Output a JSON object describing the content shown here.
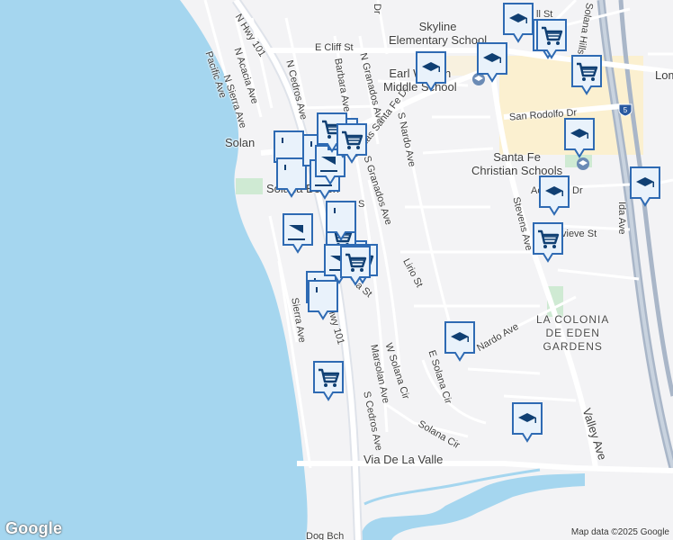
{
  "map": {
    "colors": {
      "water": "#a5d6ef",
      "land": "#f3f3f5",
      "road": "#ffffff",
      "freeway": "#a9b6c8",
      "park": "#cfead3",
      "commercial": "#fbf0d0",
      "marker_fill": "#e9f2fb",
      "marker_stroke": "#2e6ab3",
      "marker_icon": "#0f3f73"
    },
    "streets": [
      {
        "text": "N Hwy 101"
      },
      {
        "text": "Pacific Ave"
      },
      {
        "text": "N Acacia Ave"
      },
      {
        "text": "N Sierra Ave"
      },
      {
        "text": "N Cedros Ave"
      },
      {
        "text": "E Cliff St"
      },
      {
        "text": "Barbara Ave"
      },
      {
        "text": "N Granados Ave"
      },
      {
        "text": "Lomas Santa Fe Dr"
      },
      {
        "text": "S Granados Ave"
      },
      {
        "text": "S Nardo Ave"
      },
      {
        "text": "Lirio St"
      },
      {
        "text": "San Rodolfo Dr"
      },
      {
        "text": "Stevens Ave"
      },
      {
        "text": "Ida Ave"
      },
      {
        "text": "Nardo Ave"
      },
      {
        "text": "W Solana Cir"
      },
      {
        "text": "E Solana Cir"
      },
      {
        "text": "Solana Cir"
      },
      {
        "text": "Marsolan Ave"
      },
      {
        "text": "S Cedros Ave"
      },
      {
        "text": "Sierra Ave"
      },
      {
        "text": "Hwy 101"
      },
      {
        "text": "Via De La Valle"
      },
      {
        "text": "Valley Ave"
      },
      {
        "text": "Dog Bch"
      },
      {
        "text": "Solana Hills Dr"
      },
      {
        "text": "Lom"
      },
      {
        "text": "Dr"
      },
      {
        "text": "ll St"
      },
      {
        "text": "Dr"
      },
      {
        "text": "Ac"
      },
      {
        "text": "vieve St"
      },
      {
        "text": "Solan"
      },
      {
        "text": "Solana Beach"
      },
      {
        "text": "S"
      },
      {
        "text": "a St"
      }
    ],
    "places": [
      {
        "text": "Skyline\nElementary School"
      },
      {
        "text": "Earl Warren\nMiddle School"
      },
      {
        "text": "Santa Fe\nChristian Schools"
      },
      {
        "text": "LA COLONIA\nDE EDEN\nGARDENS"
      }
    ],
    "markers": [
      {
        "kind": "school",
        "icon": "graduation-cap-icon"
      },
      {
        "kind": "school",
        "icon": "graduation-cap-icon"
      },
      {
        "kind": "school",
        "icon": "graduation-cap-icon"
      },
      {
        "kind": "school",
        "icon": "graduation-cap-icon"
      },
      {
        "kind": "school",
        "icon": "graduation-cap-icon"
      },
      {
        "kind": "school",
        "icon": "graduation-cap-icon"
      },
      {
        "kind": "school",
        "icon": "graduation-cap-icon"
      },
      {
        "kind": "school",
        "icon": "graduation-cap-icon"
      },
      {
        "kind": "school",
        "icon": "graduation-cap-icon"
      },
      {
        "kind": "shopping",
        "icon": "shopping-cart-icon"
      },
      {
        "kind": "shopping",
        "icon": "shopping-cart-icon"
      },
      {
        "kind": "shopping",
        "icon": "shopping-cart-icon"
      },
      {
        "kind": "shopping",
        "icon": "shopping-cart-icon"
      },
      {
        "kind": "shopping",
        "icon": "shopping-cart-icon"
      },
      {
        "kind": "shopping",
        "icon": "shopping-cart-icon"
      },
      {
        "kind": "restaurant",
        "icon": "fork-knife-icon"
      },
      {
        "kind": "restaurant",
        "icon": "fork-knife-icon"
      },
      {
        "kind": "restaurant",
        "icon": "fork-knife-icon"
      },
      {
        "kind": "restaurant",
        "icon": "fork-knife-icon"
      },
      {
        "kind": "restaurant",
        "icon": "fork-knife-icon"
      },
      {
        "kind": "cafe",
        "icon": "coffee-cup-icon"
      },
      {
        "kind": "cafe",
        "icon": "coffee-cup-icon"
      },
      {
        "kind": "cafe",
        "icon": "coffee-cup-icon"
      },
      {
        "kind": "shopping",
        "icon": "shopping-cart-icon"
      },
      {
        "kind": "shopping",
        "icon": "shopping-cart-icon"
      },
      {
        "kind": "shopping",
        "icon": "shopping-cart-icon"
      },
      {
        "kind": "restaurant",
        "icon": "fork-knife-icon"
      },
      {
        "kind": "cafe",
        "icon": "coffee-cup-icon"
      },
      {
        "kind": "shopping",
        "icon": "shopping-cart-icon"
      },
      {
        "kind": "shopping",
        "icon": "shopping-cart-icon"
      }
    ],
    "attribution": "Map data ©2025 Google",
    "logo": "Google"
  }
}
